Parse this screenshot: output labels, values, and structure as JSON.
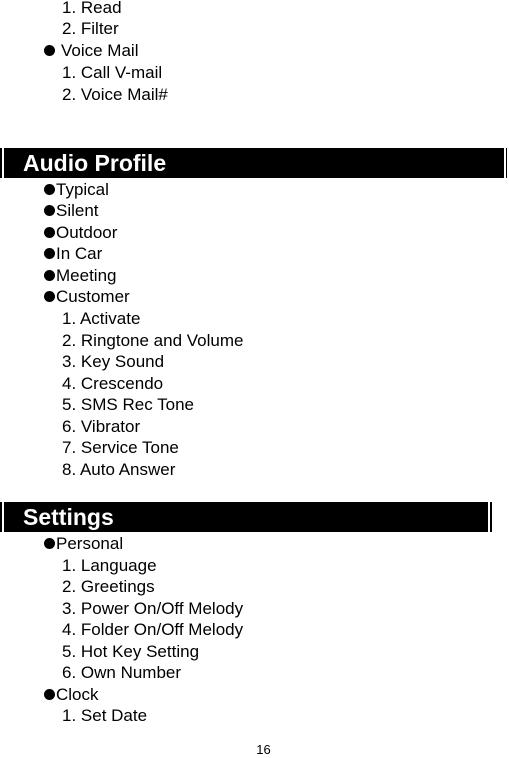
{
  "top_section": {
    "items": [
      {
        "type": "sub",
        "label": "1. Read"
      },
      {
        "type": "sub",
        "label": "2. Filter"
      },
      {
        "type": "bullet",
        "label": "Voice Mail"
      },
      {
        "type": "sub",
        "label": "1. Call V-mail"
      },
      {
        "type": "sub",
        "label": "2. Voice Mail#"
      }
    ]
  },
  "audio_profile": {
    "title": "Audio Profile",
    "items": [
      {
        "type": "bullet",
        "label": "Typical"
      },
      {
        "type": "bullet",
        "label": "Silent"
      },
      {
        "type": "bullet",
        "label": "Outdoor"
      },
      {
        "type": "bullet",
        "label": "In Car"
      },
      {
        "type": "bullet",
        "label": "Meeting"
      },
      {
        "type": "bullet",
        "label": "Customer"
      },
      {
        "type": "sub",
        "label": "1. Activate"
      },
      {
        "type": "sub",
        "label": "2. Ringtone and Volume"
      },
      {
        "type": "sub",
        "label": "3. Key Sound"
      },
      {
        "type": "sub",
        "label": "4. Crescendo"
      },
      {
        "type": "sub",
        "label": "5. SMS Rec Tone"
      },
      {
        "type": "sub",
        "label": "6. Vibrator"
      },
      {
        "type": "sub",
        "label": "7. Service Tone"
      },
      {
        "type": "sub",
        "label": "8. Auto Answer"
      }
    ]
  },
  "settings": {
    "title": "Settings",
    "items": [
      {
        "type": "bullet",
        "label": "Personal"
      },
      {
        "type": "sub",
        "label": "1. Language"
      },
      {
        "type": "sub",
        "label": "2. Greetings"
      },
      {
        "type": "sub",
        "label": "3. Power On/Off Melody"
      },
      {
        "type": "sub",
        "label": "4. Folder On/Off Melody"
      },
      {
        "type": "sub",
        "label": "5. Hot Key Setting"
      },
      {
        "type": "sub",
        "label": "6. Own Number"
      },
      {
        "type": "bullet",
        "label": "Clock"
      },
      {
        "type": "sub",
        "label": "1. Set Date"
      }
    ]
  },
  "footer": {
    "page_number": "16"
  }
}
